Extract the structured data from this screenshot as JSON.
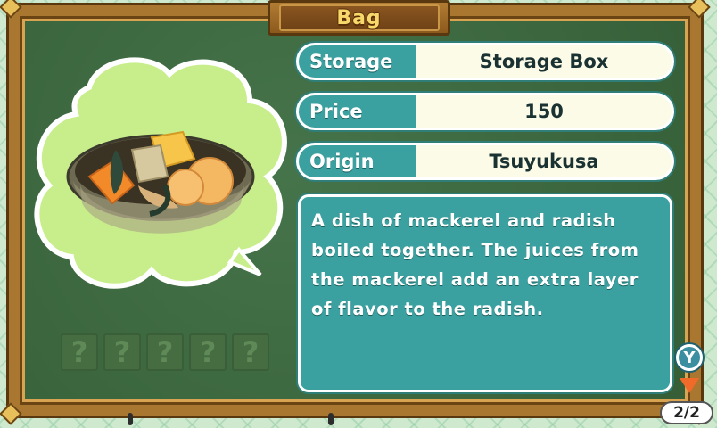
{
  "header": {
    "title": "Bag"
  },
  "item": {
    "image": "mackerel-radish-stew-bowl",
    "stats": [
      {
        "label": "Storage",
        "value": "Storage Box"
      },
      {
        "label": "Price",
        "value": "150"
      },
      {
        "label": "Origin",
        "value": "Tsuyukusa"
      }
    ],
    "description_lines": [
      "A dish of mackerel and radish",
      "boiled together. The juices from",
      "the mackerel add an extra layer",
      "of flavor to the radish."
    ]
  },
  "unknown_slots": [
    "?",
    "?",
    "?",
    "?",
    "?"
  ],
  "controls": {
    "y_button_label": "Y",
    "page_indicator": "2/2"
  },
  "colors": {
    "frame_wood": "#a9772f",
    "board_green": "#3e6a3e",
    "panel_teal": "#3aa0a0",
    "title_gold": "#f7d86a",
    "cloud_green": "#c8ee8c",
    "arrow_orange": "#f06a2a"
  }
}
